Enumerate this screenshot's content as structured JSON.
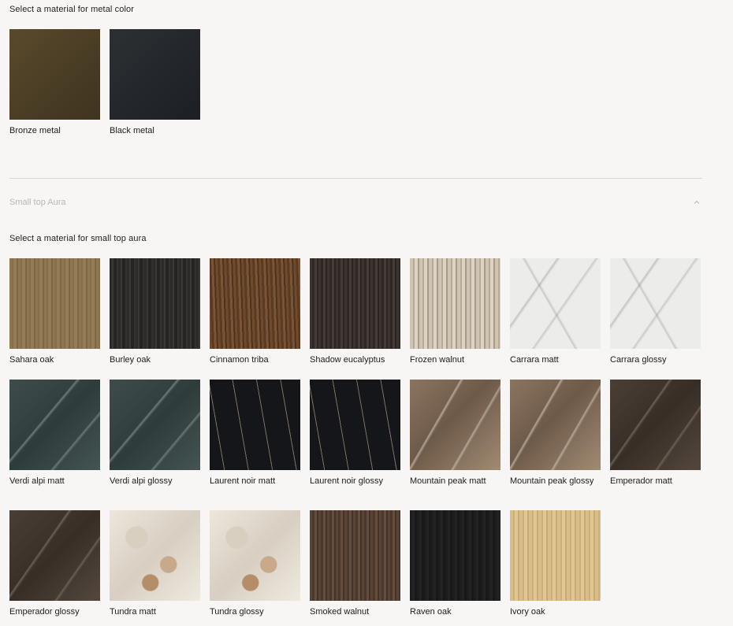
{
  "metal": {
    "label": "Select a material for metal color",
    "options": [
      {
        "name": "Bronze metal",
        "texture": "tx-bronze"
      },
      {
        "name": "Black metal",
        "texture": "tx-black"
      }
    ]
  },
  "accordion": {
    "title": "Small top Aura",
    "expanded": true,
    "icon": "chevron-up-icon"
  },
  "aura": {
    "label": "Select a material for small top aura",
    "options": [
      {
        "name": "Sahara oak",
        "texture": "tx-sahara"
      },
      {
        "name": "Burley oak",
        "texture": "tx-burley"
      },
      {
        "name": "Cinnamon triba",
        "texture": "tx-cinnamon"
      },
      {
        "name": "Shadow eucalyptus",
        "texture": "tx-shadow"
      },
      {
        "name": "Frozen walnut",
        "texture": "tx-frozen"
      },
      {
        "name": "Carrara matt",
        "texture": "tx-carrara"
      },
      {
        "name": "Carrara glossy",
        "texture": "tx-carrara"
      },
      {
        "name": "Verdi alpi matt",
        "texture": "tx-verdi"
      },
      {
        "name": "Verdi alpi glossy",
        "texture": "tx-verdi"
      },
      {
        "name": "Laurent noir matt",
        "texture": "tx-laurent"
      },
      {
        "name": "Laurent noir glossy",
        "texture": "tx-laurent"
      },
      {
        "name": "Mountain peak matt",
        "texture": "tx-mountain"
      },
      {
        "name": "Mountain peak glossy",
        "texture": "tx-mountain"
      },
      {
        "name": "Emperador matt",
        "texture": "tx-emperador"
      },
      {
        "name": "Emperador glossy",
        "texture": "tx-emperador"
      },
      {
        "name": "Tundra matt",
        "texture": "tx-tundra"
      },
      {
        "name": "Tundra glossy",
        "texture": "tx-tundra"
      },
      {
        "name": "Smoked walnut",
        "texture": "tx-smoked"
      },
      {
        "name": "Raven oak",
        "texture": "tx-raven"
      },
      {
        "name": "Ivory oak",
        "texture": "tx-ivory"
      }
    ]
  }
}
